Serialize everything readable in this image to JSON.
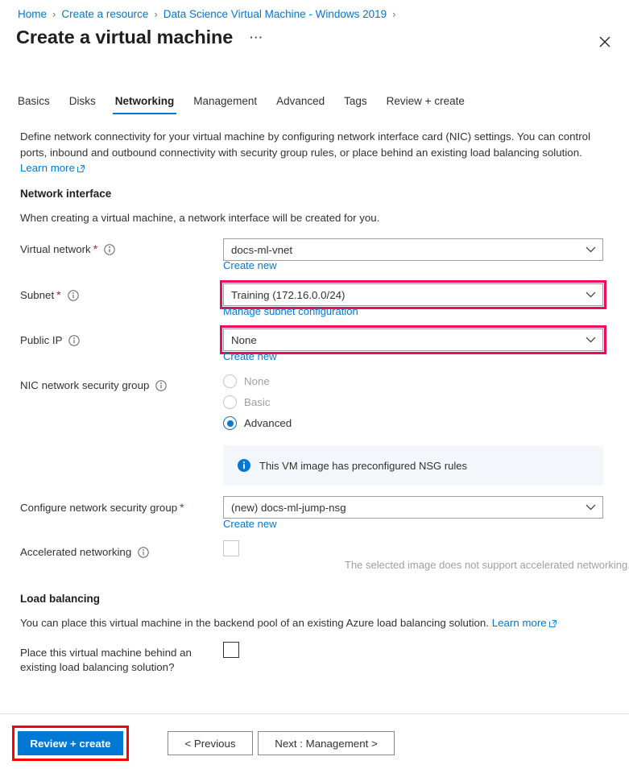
{
  "breadcrumb": {
    "separator": "›",
    "items": [
      {
        "label": "Home"
      },
      {
        "label": "Create a resource"
      },
      {
        "label": "Data Science Virtual Machine - Windows 2019"
      }
    ]
  },
  "header": {
    "title": "Create a virtual machine",
    "more_label": "⋯",
    "close_icon": "close-icon"
  },
  "tabs": [
    {
      "label": "Basics",
      "active": false
    },
    {
      "label": "Disks",
      "active": false
    },
    {
      "label": "Networking",
      "active": true
    },
    {
      "label": "Management",
      "active": false
    },
    {
      "label": "Advanced",
      "active": false
    },
    {
      "label": "Tags",
      "active": false
    },
    {
      "label": "Review + create",
      "active": false
    }
  ],
  "intro": {
    "text": "Define network connectivity for your virtual machine by configuring network interface card (NIC) settings. You can control ports, inbound and outbound connectivity with security group rules, or place behind an existing load balancing solution.",
    "learn_more": "Learn more"
  },
  "network_interface": {
    "heading": "Network interface",
    "subtext": "When creating a virtual machine, a network interface will be created for you.",
    "virtual_network": {
      "label": "Virtual network",
      "required": "*",
      "value": "docs-ml-vnet",
      "sublink": "Create new",
      "highlighted": false
    },
    "subnet": {
      "label": "Subnet",
      "required": "*",
      "value": "Training (172.16.0.0/24)",
      "sublink": "Manage subnet configuration",
      "highlighted": true
    },
    "public_ip": {
      "label": "Public IP",
      "required": "",
      "value": "None",
      "sublink": "Create new",
      "highlighted": true
    },
    "nic_nsg": {
      "label": "NIC network security group",
      "options": [
        {
          "label": "None",
          "selected": false,
          "disabled": true
        },
        {
          "label": "Basic",
          "selected": false,
          "disabled": true
        },
        {
          "label": "Advanced",
          "selected": true,
          "disabled": false
        }
      ],
      "info_banner": "This VM image has preconfigured NSG rules"
    },
    "configure_nsg": {
      "label": "Configure network security group",
      "required": "*",
      "value": "(new) docs-ml-jump-nsg",
      "sublink": "Create new",
      "highlighted": false
    },
    "accelerated_networking": {
      "label": "Accelerated networking",
      "checked": false,
      "disabled": true,
      "note": "The selected image does not support accelerated networking."
    }
  },
  "load_balancing": {
    "heading": "Load balancing",
    "subtext": "You can place this virtual machine in the backend pool of an existing Azure load balancing solution.",
    "learn_more": "Learn more",
    "place_behind": {
      "label_line1": "Place this virtual machine behind an",
      "label_line2": "existing load balancing solution?",
      "checked": false
    }
  },
  "footer": {
    "review_create": "Review + create",
    "previous": "< Previous",
    "next": "Next : Management >"
  },
  "colors": {
    "accent_blue": "#0078d4",
    "highlight_crimson": "#ee0a5f",
    "highlight_red": "#ff0000",
    "required_red": "#a4262c",
    "info_banner_bg": "#f3f7fb",
    "disabled_gray": "#a19f9d"
  }
}
